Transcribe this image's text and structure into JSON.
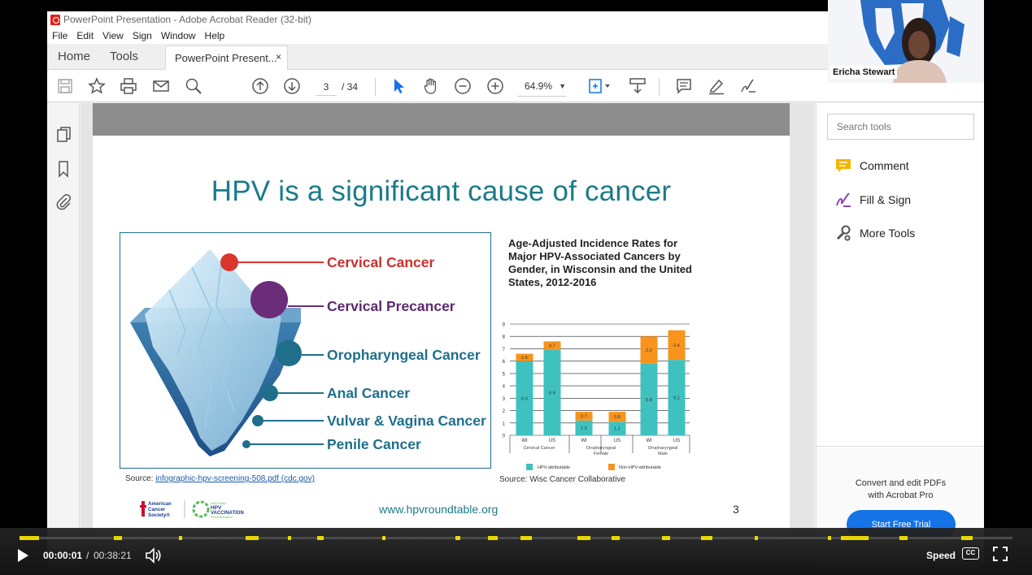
{
  "window": {
    "title": "PowerPoint Presentation - Adobe Acrobat Reader (32-bit)",
    "menu": [
      "File",
      "Edit",
      "View",
      "Sign",
      "Window",
      "Help"
    ]
  },
  "tabs": {
    "home": "Home",
    "tools": "Tools",
    "document": "PowerPoint Present...",
    "close": "×"
  },
  "toolbar": {
    "page_current": "3",
    "page_total": "/ 34",
    "zoom": "64.9%",
    "icons": [
      "save-icon",
      "bookmark-star-icon",
      "print-icon",
      "email-icon",
      "search-zoom-icon",
      "page-up-icon",
      "page-down-icon",
      "select-cursor-icon",
      "hand-icon",
      "zoom-out-icon",
      "zoom-in-icon",
      "page-fit-icon",
      "scroll-mode-icon",
      "comment-icon",
      "highlight-icon",
      "sign-icon"
    ]
  },
  "left_rail": {
    "icons": [
      "pages-icon",
      "bookmarks-icon",
      "attachments-icon"
    ]
  },
  "tools_pane": {
    "search_placeholder": "Search tools",
    "items": [
      {
        "label": "Comment",
        "icon": "comment-icon",
        "color": "#f5b400"
      },
      {
        "label": "Fill & Sign",
        "icon": "fill-sign-icon",
        "color": "#8e44ad"
      },
      {
        "label": "More Tools",
        "icon": "more-tools-icon",
        "color": "#555555"
      }
    ],
    "promo_line1": "Convert and edit PDFs",
    "promo_line2": "with Acrobat Pro",
    "trial_button": "Start Free Trial"
  },
  "slide": {
    "title": "HPV is a significant cause of cancer",
    "iceberg_labels": [
      {
        "text": "Cervical Cancer",
        "color": "#c9302c"
      },
      {
        "text": "Cervical Precancer",
        "color": "#5b2a6e"
      },
      {
        "text": "Oropharyngeal Cancer",
        "color": "#1f6f8b"
      },
      {
        "text": "Anal Cancer",
        "color": "#1f6f8b"
      },
      {
        "text": "Vulvar & Vagina Cancer",
        "color": "#1f6f8b"
      },
      {
        "text": "Penile Cancer",
        "color": "#1f6f8b"
      }
    ],
    "iceberg_source_prefix": "Source: ",
    "iceberg_source_link": "infographic-hpv-screening-508.pdf (cdc.gov)",
    "chart_source": "Source: Wisc Cancer Collaborative",
    "website": "www.hpvroundtable.org",
    "page_number": "3",
    "logos": [
      "american-cancer-society-logo",
      "national-hpv-vaccination-roundtable-logo"
    ]
  },
  "chart_data": {
    "type": "bar",
    "stacked": true,
    "title": "Age-Adjusted Incidence Rates for Major HPV-Associated Cancers by Gender, in Wisconsin and the United States, 2012-2016",
    "categories": [
      "WI",
      "US",
      "WI",
      "US",
      "WI",
      "US"
    ],
    "groups": [
      {
        "label": "Cervical Cancer",
        "categories": [
          "WI",
          "US"
        ]
      },
      {
        "label": "Oropharyngeal Female",
        "categories": [
          "WI",
          "US"
        ]
      },
      {
        "label": "Oropharyngeal Male",
        "categories": [
          "WI",
          "US"
        ]
      }
    ],
    "series": [
      {
        "name": "HPV-attributable",
        "color": "#3fc1c0",
        "values": [
          6.0,
          6.9,
          1.2,
          1.1,
          5.8,
          6.1
        ]
      },
      {
        "name": "Non-HPV-attributable",
        "color": "#f7941d",
        "values": [
          0.6,
          0.7,
          0.7,
          0.8,
          2.2,
          2.4
        ]
      }
    ],
    "ylim": [
      0,
      9
    ],
    "yticks": [
      0,
      1,
      2,
      3,
      4,
      5,
      6,
      7,
      8,
      9
    ],
    "grid": true,
    "legend_position": "bottom"
  },
  "webcam": {
    "name": "Ericha Stewart"
  },
  "player": {
    "time_current": "00:00:01",
    "time_separator": "/",
    "time_total": "00:38:21",
    "progress": 0.0004,
    "speed": "Speed",
    "cc": "CC",
    "colors": {
      "progress": "#f5e200"
    }
  }
}
